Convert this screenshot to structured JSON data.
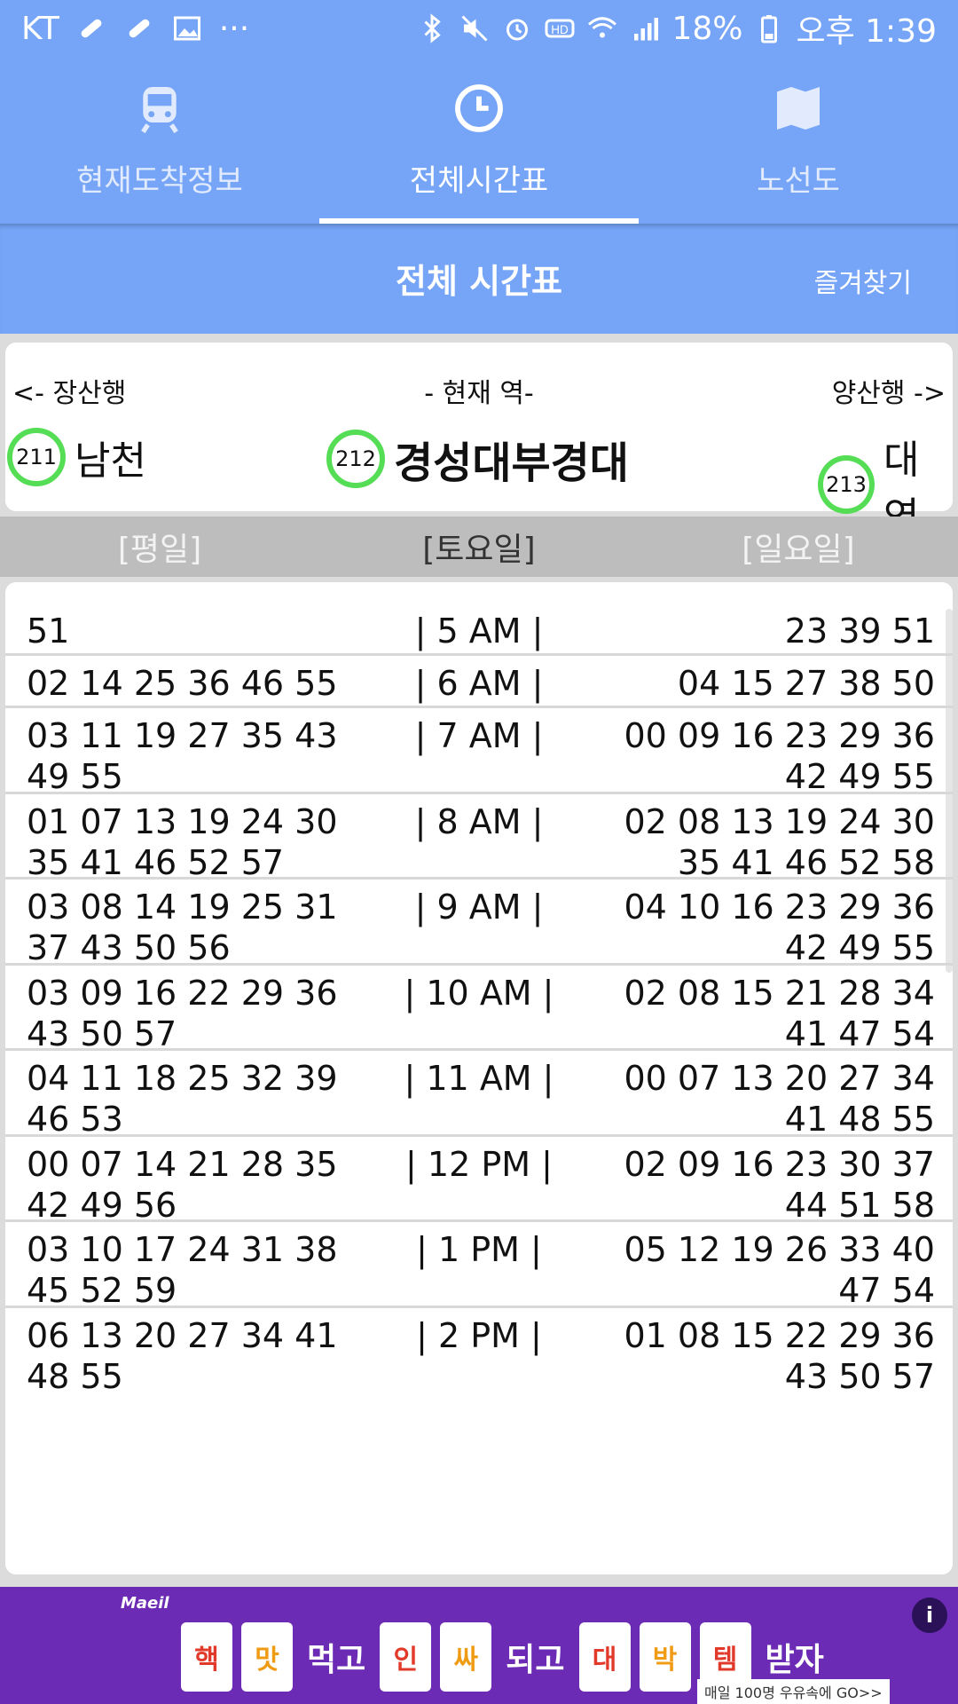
{
  "status_bar": {
    "carrier": "KT",
    "more": "···",
    "battery": "18%",
    "time": "오후 1:39",
    "icons": [
      "bandage-icon",
      "bandage-icon",
      "image-icon",
      "bluetooth-icon",
      "mute-icon",
      "alarm-icon",
      "hd-icon",
      "wifi-icon",
      "signal-icon",
      "battery-icon"
    ]
  },
  "tabs": [
    {
      "label": "현재도착정보",
      "icon": "train-icon",
      "active": false
    },
    {
      "label": "전체시간표",
      "icon": "clock-icon",
      "active": true
    },
    {
      "label": "노선도",
      "icon": "map-icon",
      "active": false
    }
  ],
  "header": {
    "title": "전체 시간표",
    "favorite": "즐겨찾기"
  },
  "station_card": {
    "left_dir": "<- 장산행",
    "center_dir": "- 현재 역-",
    "right_dir": "양산행 ->",
    "prev": {
      "number": "211",
      "name": "남천"
    },
    "current": {
      "number": "212",
      "name": "경성대부경대"
    },
    "next": {
      "number": "213",
      "name": "대연"
    },
    "line_color": "#55dd55"
  },
  "day_tabs": {
    "weekday": "[평일]",
    "saturday": "[토요일]",
    "sunday": "[일요일]"
  },
  "timetable": [
    {
      "weekday": [
        "51"
      ],
      "hour": "| 5 AM |",
      "sunday": [
        "23 39 51"
      ]
    },
    {
      "weekday": [
        "02 14 25 36 46 55"
      ],
      "hour": "| 6 AM |",
      "sunday": [
        "04 15 27 38 50"
      ]
    },
    {
      "weekday": [
        "03 11 19 27 35 43",
        "49 55"
      ],
      "hour": "| 7 AM |",
      "sunday": [
        "00 09 16 23 29 36",
        "42 49 55"
      ]
    },
    {
      "weekday": [
        "01 07 13 19 24 30",
        "35 41 46 52 57"
      ],
      "hour": "| 8 AM |",
      "sunday": [
        "02 08 13 19 24 30",
        "35 41 46 52 58"
      ]
    },
    {
      "weekday": [
        "03 08 14 19 25 31",
        "37 43 50 56"
      ],
      "hour": "| 9 AM |",
      "sunday": [
        "04 10 16 23 29 36",
        "42 49 55"
      ]
    },
    {
      "weekday": [
        "03 09 16 22 29 36",
        "43 50 57"
      ],
      "hour": "| 10 AM |",
      "sunday": [
        "02 08 15 21 28 34",
        "41 47 54"
      ]
    },
    {
      "weekday": [
        "04 11 18 25 32 39",
        "46 53"
      ],
      "hour": "| 11 AM |",
      "sunday": [
        "00 07 13 20 27 34",
        "41 48 55"
      ]
    },
    {
      "weekday": [
        "00 07 14 21 28 35",
        "42 49 56"
      ],
      "hour": "| 12 PM |",
      "sunday": [
        "02 09 16 23 30 37",
        "44 51 58"
      ]
    },
    {
      "weekday": [
        "03 10 17 24 31 38",
        "45 52 59"
      ],
      "hour": "| 1 PM |",
      "sunday": [
        "05 12 19 26 33 40",
        "47 54"
      ]
    },
    {
      "weekday": [
        "06 13 20 27 34 41",
        "48 55"
      ],
      "hour": "| 2 PM |",
      "sunday": [
        "01 08 15 22 29 36",
        "43 50 57"
      ]
    }
  ],
  "ad": {
    "brand": "Maeil",
    "slogan": [
      {
        "type": "carton",
        "text": "핵"
      },
      {
        "type": "carton",
        "text": "맛"
      },
      {
        "type": "word",
        "text": "먹고"
      },
      {
        "type": "carton",
        "text": "인"
      },
      {
        "type": "carton",
        "text": "싸"
      },
      {
        "type": "word",
        "text": "되고"
      },
      {
        "type": "carton",
        "text": "대"
      },
      {
        "type": "carton",
        "text": "박"
      },
      {
        "type": "carton",
        "text": "템"
      },
      {
        "type": "word",
        "text": "받자"
      }
    ],
    "cta": "매일 100명 우유속에 GO>>",
    "info": "i"
  }
}
